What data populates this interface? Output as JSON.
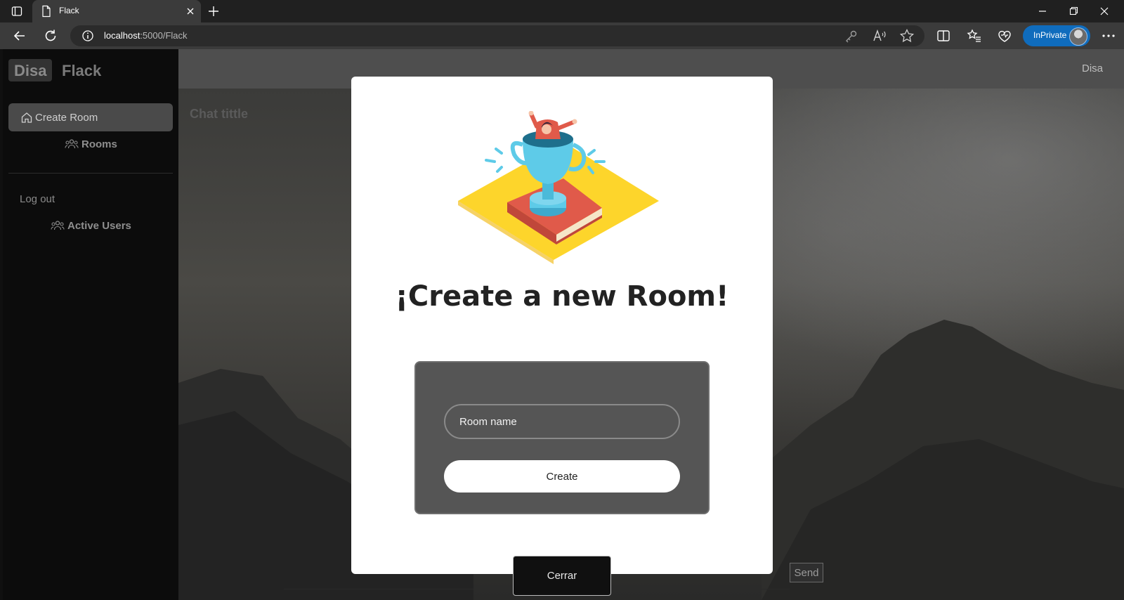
{
  "browser": {
    "tab_title": "Flack",
    "url_host": "localhost",
    "url_rest": ":5000/Flack",
    "inprivate_label": "InPrivate"
  },
  "page": {
    "brand": {
      "badge": "Disa",
      "name": "Flack"
    },
    "topnav_user": "Disa",
    "sidebar": {
      "create_room": "Create Room",
      "rooms": "Rooms",
      "logout": "Log out",
      "active_users": "Active Users"
    },
    "chat_title": "Chat tittle",
    "send_label": "Send"
  },
  "modal": {
    "heading": "¡Create a new Room!",
    "room_input_placeholder": "Room name",
    "create_label": "Create",
    "close_label": "Cerrar"
  },
  "colors": {
    "accent_inprivate": "#0f6cbd",
    "illustration_yellow": "#fdd52b",
    "illustration_red": "#e05a4a",
    "illustration_cup": "#5ecbe8"
  }
}
